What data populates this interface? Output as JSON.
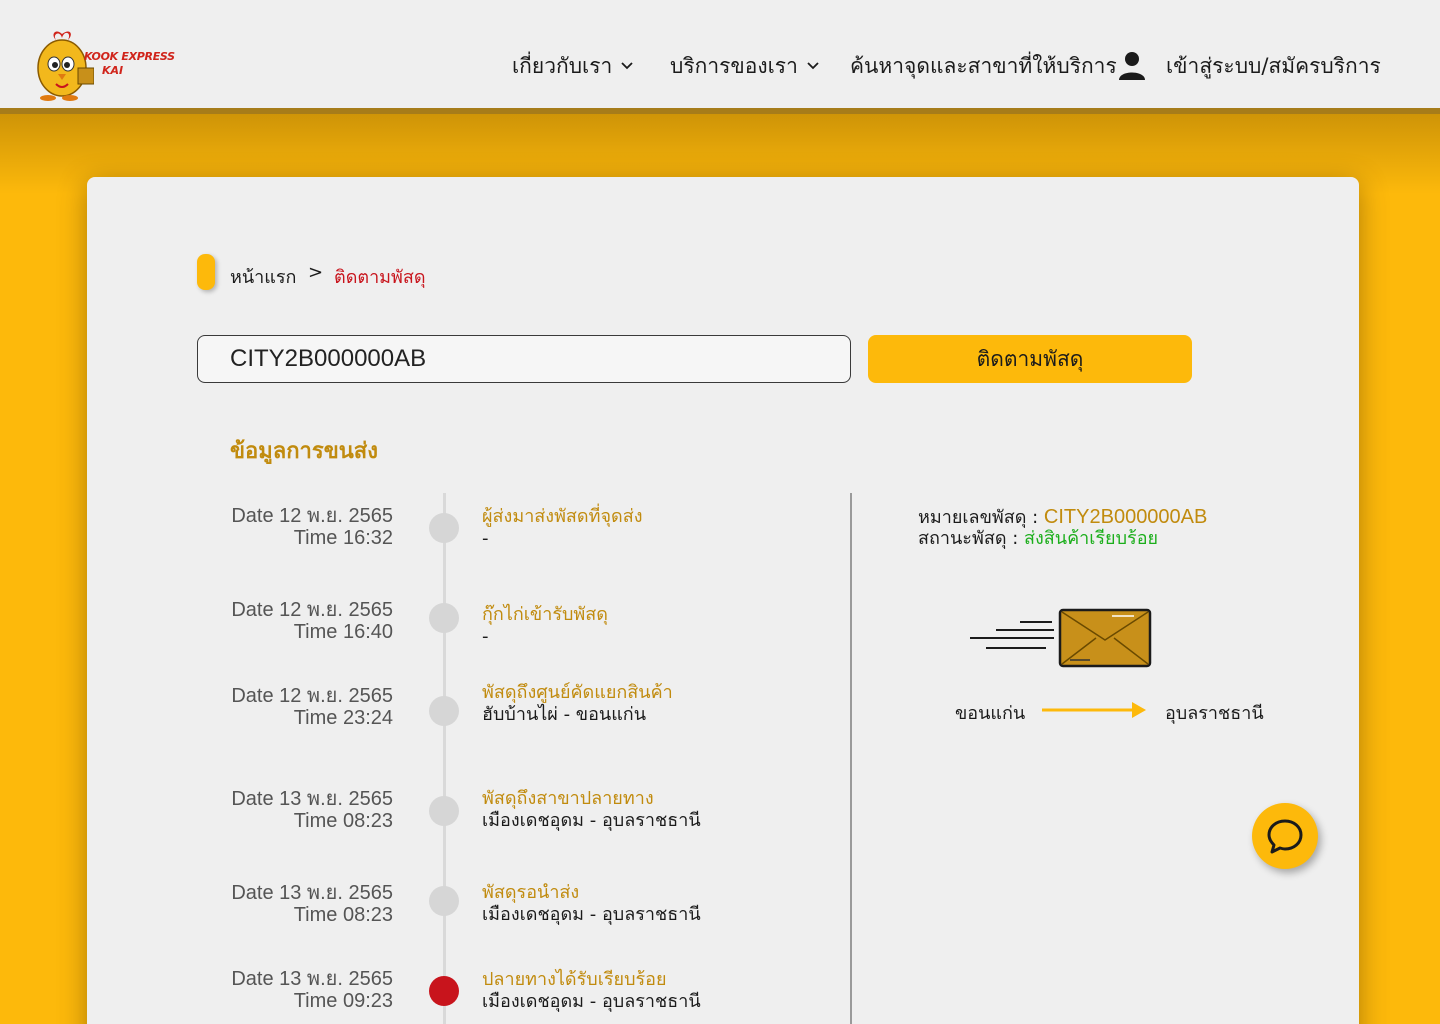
{
  "header": {
    "logo_text_top": "KOOK EXPRESS",
    "logo_text_bottom": "KAI",
    "nav": {
      "about": "เกี่ยวกับเรา",
      "services": "บริการของเรา",
      "branches": "ค้นหาจุดและสาขาที่ให้บริการ",
      "login": "เข้าสู่ระบบ/สมัครบริการ"
    }
  },
  "breadcrumb": {
    "home": "หน้าแรก",
    "separator": ">",
    "current": "ติดตามพัสดุ"
  },
  "search": {
    "value": "CITY2B000000AB",
    "button_label": "ติดตามพัสดุ"
  },
  "section_title": "ข้อมูลการขนส่ง",
  "events": [
    {
      "date": "Date 12 พ.ย. 2565",
      "time": "Time 16:32",
      "title": "ผู้ส่งมาส่งพัสดที่จุดส่ง",
      "sub": "-"
    },
    {
      "date": "Date 12 พ.ย. 2565",
      "time": "Time 16:40",
      "title": "กุ๊กไก่เข้ารับพัสดุ",
      "sub": "-"
    },
    {
      "date": "Date 12 พ.ย. 2565",
      "time": "Time 23:24",
      "title": "พัสดุถึงศูนย์คัดแยกสินค้า",
      "sub": "ฮับบ้านไผ่ - ขอนแก่น"
    },
    {
      "date": "Date 13 พ.ย. 2565",
      "time": "Time 08:23",
      "title": "พัสดุถึงสาขาปลายทาง",
      "sub": "เมืองเดชอุดม - อุบลราชธานี"
    },
    {
      "date": "Date 13 พ.ย. 2565",
      "time": "Time 08:23",
      "title": "พัสดุรอนำส่ง",
      "sub": "เมืองเดชอุดม - อุบลราชธานี"
    },
    {
      "date": "Date 13 พ.ย. 2565",
      "time": "Time 09:23",
      "title": "ปลายทางได้รับเรียบร้อย",
      "sub": "เมืองเดชอุดม - อุบลราชธานี"
    }
  ],
  "info": {
    "tracking_label": "หมายเลขพัสดุ : ",
    "tracking_value": "CITY2B000000AB",
    "status_label": "สถานะพัสดุ : ",
    "status_value": "ส่งสินค้าเรียบร้อย",
    "route_from": "ขอนแก่น",
    "route_to": "อุบลราชธานี"
  },
  "colors": {
    "brand_yellow": "#FDB90B",
    "accent_gold": "#C18B0E",
    "current_red": "#C8141C",
    "status_green": "#1BAE1B"
  }
}
